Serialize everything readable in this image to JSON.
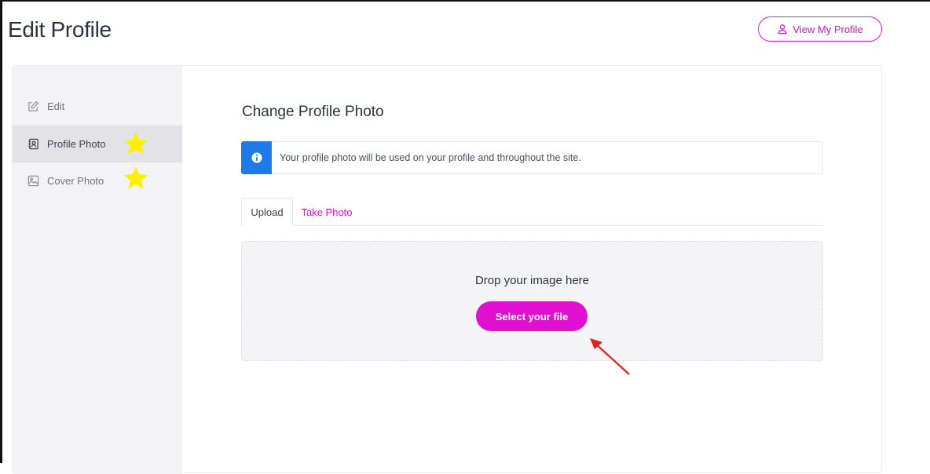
{
  "header": {
    "title": "Edit Profile",
    "view_profile_label": "View My Profile",
    "view_profile_icon": "user-icon"
  },
  "sidebar": {
    "items": [
      {
        "label": "Edit",
        "icon": "edit-icon",
        "active": false
      },
      {
        "label": "Profile Photo",
        "icon": "contact-card-icon",
        "active": true
      },
      {
        "label": "Cover Photo",
        "icon": "image-icon",
        "active": false
      }
    ]
  },
  "main": {
    "section_title": "Change Profile Photo",
    "info_text": "Your profile photo will be used on your profile and throughout the site.",
    "tabs": [
      {
        "label": "Upload",
        "active": true
      },
      {
        "label": "Take Photo",
        "active": false
      }
    ],
    "dropzone": {
      "prompt": "Drop your image here",
      "button_label": "Select your file"
    }
  },
  "colors": {
    "accent": "#e10fcf",
    "info": "#1e7ae6",
    "annotation_star": "#ffef00",
    "annotation_arrow": "#e8201c"
  }
}
